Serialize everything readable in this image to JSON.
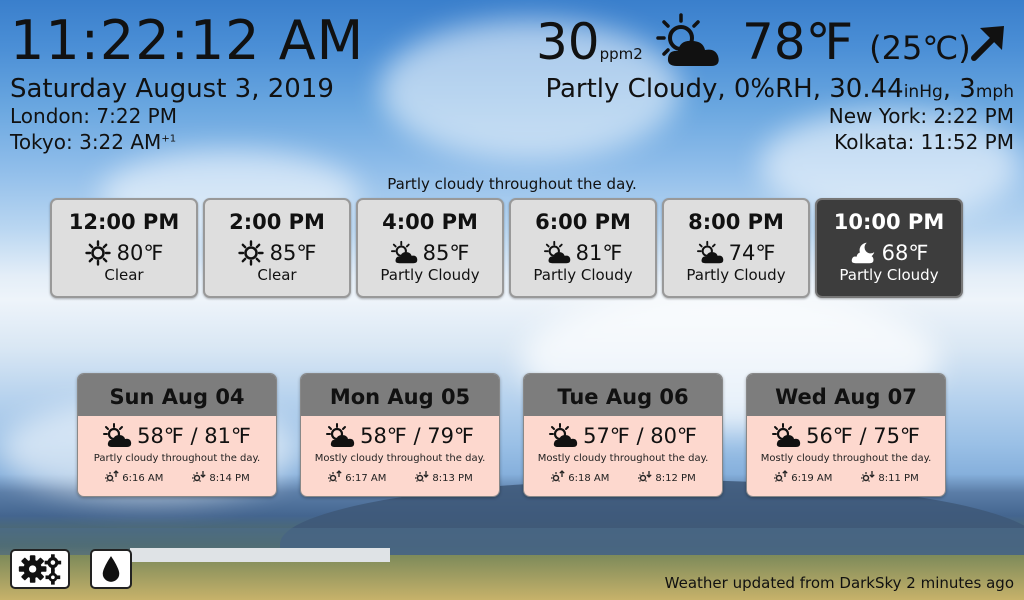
{
  "clock": {
    "time": "11:22:12 AM",
    "date": "Saturday August 3, 2019"
  },
  "world_clocks": {
    "left": [
      {
        "city_time": "London: 7:22 PM",
        "suffix": ""
      },
      {
        "city_time": "Tokyo: 3:22 AM",
        "suffix": "+1"
      }
    ],
    "right": [
      {
        "city_time": "New York: 2:22 PM"
      },
      {
        "city_time": "Kolkata: 11:52 PM"
      }
    ]
  },
  "current": {
    "aqi": "30",
    "aqi_unit": "ppm2",
    "icon": "partly-cloudy-day-icon",
    "temp_f": "78℉",
    "temp_c": "(25℃)",
    "wind_icon": "wind-direction-arrow-icon",
    "summary_prefix": "Partly Cloudy, 0%RH, 30.44",
    "pressure_unit": "inHg",
    "wind_value": ", 3",
    "wind_unit": "mph"
  },
  "day_summary": "Partly cloudy throughout the day.",
  "hourly": [
    {
      "time": "12:00 PM",
      "temp": "80℉",
      "condition": "Clear",
      "icon": "clear-day-icon"
    },
    {
      "time": "2:00 PM",
      "temp": "85℉",
      "condition": "Clear",
      "icon": "clear-day-icon"
    },
    {
      "time": "4:00 PM",
      "temp": "85℉",
      "condition": "Partly Cloudy",
      "icon": "partly-cloudy-day-icon"
    },
    {
      "time": "6:00 PM",
      "temp": "81℉",
      "condition": "Partly Cloudy",
      "icon": "partly-cloudy-day-icon"
    },
    {
      "time": "8:00 PM",
      "temp": "74℉",
      "condition": "Partly Cloudy",
      "icon": "partly-cloudy-day-icon"
    },
    {
      "time": "10:00 PM",
      "temp": "68℉",
      "condition": "Partly Cloudy",
      "icon": "partly-cloudy-night-icon",
      "highlighted": true
    }
  ],
  "daily": [
    {
      "day": "Sun Aug 04",
      "temps": "58℉ / 81℉",
      "summary": "Partly cloudy throughout the day.",
      "sunrise": "6:16 AM",
      "sunset": "8:14 PM"
    },
    {
      "day": "Mon Aug 05",
      "temps": "58℉ / 79℉",
      "summary": "Mostly cloudy throughout the day.",
      "sunrise": "6:17 AM",
      "sunset": "8:13 PM"
    },
    {
      "day": "Tue Aug 06",
      "temps": "57℉ / 80℉",
      "summary": "Mostly cloudy throughout the day.",
      "sunrise": "6:18 AM",
      "sunset": "8:12 PM"
    },
    {
      "day": "Wed Aug 07",
      "temps": "56℉ / 75℉",
      "summary": "Mostly cloudy throughout the day.",
      "sunrise": "6:19 AM",
      "sunset": "8:11 PM"
    }
  ],
  "buttons": {
    "settings_icon": "gears-icon",
    "humidity_icon": "water-drop-icon"
  },
  "footer": "Weather updated from DarkSky 2 minutes ago",
  "colors": {
    "hourly_card": "#dedede",
    "hourly_highlight": "#3d3d3d",
    "daily_header": "#7d7d7d",
    "daily_body": "#fdd8ce"
  }
}
